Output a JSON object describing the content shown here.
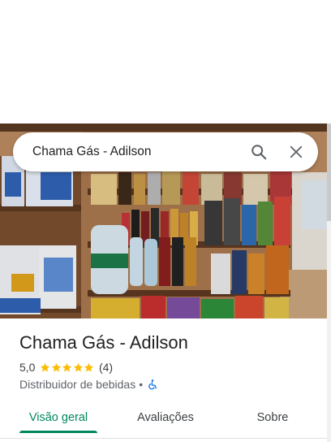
{
  "search": {
    "query": "Chama Gás - Adilson"
  },
  "place": {
    "name": "Chama Gás - Adilson",
    "rating": "5,0",
    "star_count": 5,
    "reviews_count": "(4)",
    "category": "Distribuidor de bebidas",
    "separator": "•",
    "accessibility_icon": "wheelchair-icon"
  },
  "tabs": [
    {
      "label": "Visão geral",
      "active": true
    },
    {
      "label": "Avaliações",
      "active": false
    },
    {
      "label": "Sobre",
      "active": false
    }
  ],
  "colors": {
    "accent": "#01875f",
    "star": "#fbbc04",
    "accessibility": "#1a73e8"
  }
}
